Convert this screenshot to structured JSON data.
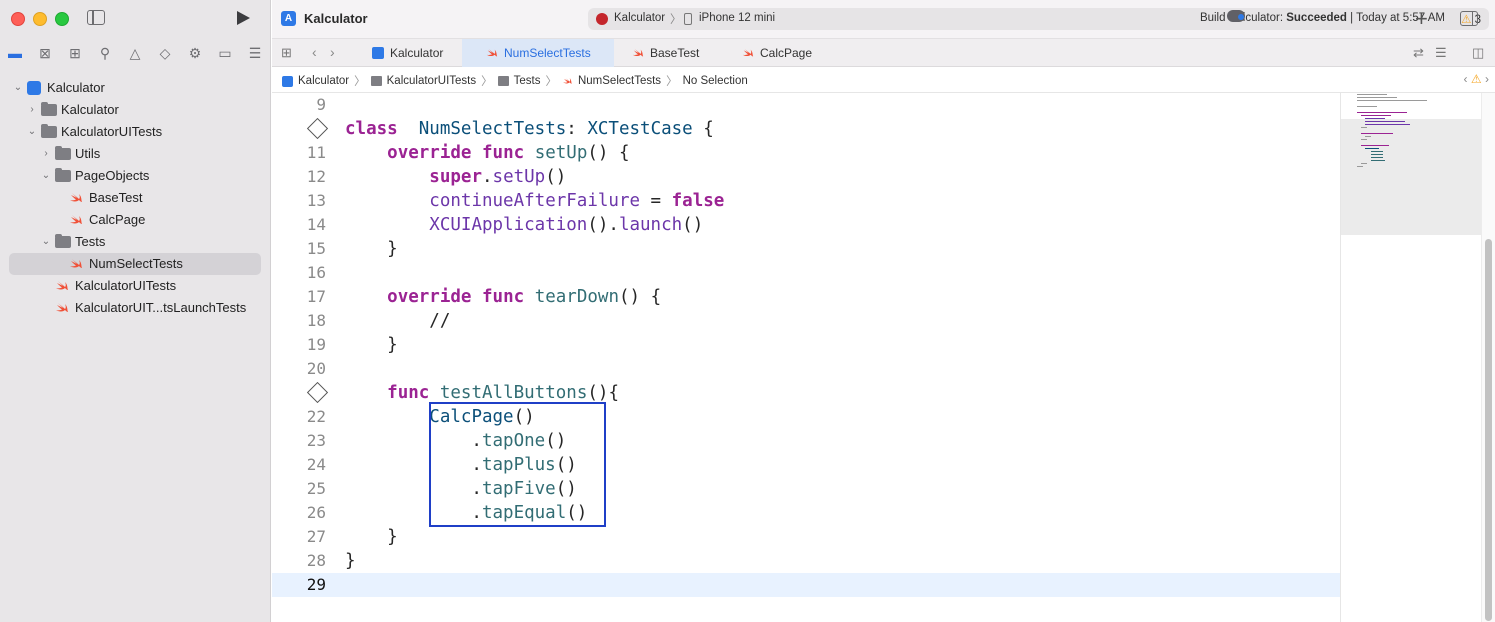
{
  "window": {
    "title": "Kalculator"
  },
  "toolbar": {
    "scheme": "Kalculator",
    "device": "iPhone 12 mini",
    "build_prefix": "Build Kalculator: ",
    "build_result": "Succeeded",
    "build_time": " | Today at 5:57 AM",
    "warning_count": "3",
    "warning_symbol": "⚠"
  },
  "navigator": {
    "tree": [
      {
        "label": "Kalculator",
        "kind": "project",
        "indent": 0,
        "disclosure": "⌄"
      },
      {
        "label": "Kalculator",
        "kind": "folder",
        "indent": 1,
        "disclosure": "›"
      },
      {
        "label": "KalculatorUITests",
        "kind": "folder",
        "indent": 1,
        "disclosure": "⌄"
      },
      {
        "label": "Utils",
        "kind": "folder",
        "indent": 2,
        "disclosure": "›"
      },
      {
        "label": "PageObjects",
        "kind": "folder",
        "indent": 2,
        "disclosure": "⌄"
      },
      {
        "label": "BaseTest",
        "kind": "swift",
        "indent": 3
      },
      {
        "label": "CalcPage",
        "kind": "swift",
        "indent": 3
      },
      {
        "label": "Tests",
        "kind": "folder",
        "indent": 2,
        "disclosure": "⌄"
      },
      {
        "label": "NumSelectTests",
        "kind": "swift",
        "indent": 3,
        "selected": true
      },
      {
        "label": "KalculatorUITests",
        "kind": "swift",
        "indent": 2
      },
      {
        "label": "KalculatorUIT...tsLaunchTests",
        "kind": "swift",
        "indent": 2
      }
    ]
  },
  "tabs": [
    {
      "label": "Kalculator",
      "kind": "project",
      "active": false
    },
    {
      "label": "NumSelectTests",
      "kind": "swift",
      "active": true
    },
    {
      "label": "BaseTest",
      "kind": "swift",
      "active": false
    },
    {
      "label": "CalcPage",
      "kind": "swift",
      "active": false
    }
  ],
  "breadcrumb": [
    {
      "label": "Kalculator",
      "kind": "project"
    },
    {
      "label": "KalculatorUITests",
      "kind": "folder"
    },
    {
      "label": "Tests",
      "kind": "folder"
    },
    {
      "label": "NumSelectTests",
      "kind": "swift"
    },
    {
      "label": "No Selection",
      "kind": "none"
    }
  ],
  "code": {
    "current_line": 29,
    "lines": [
      {
        "n": "9",
        "tokens": []
      },
      {
        "n": "",
        "diamond": true,
        "tokens": [
          [
            "kw",
            "class"
          ],
          [
            "",
            "  "
          ],
          [
            "ty",
            "NumSelectTests"
          ],
          [
            "",
            ": "
          ],
          [
            "ty",
            "XCTestCase"
          ],
          [
            "",
            " {"
          ]
        ]
      },
      {
        "n": "11",
        "tokens": [
          [
            "",
            "    "
          ],
          [
            "kw",
            "override"
          ],
          [
            "",
            " "
          ],
          [
            "kw",
            "func"
          ],
          [
            "",
            " "
          ],
          [
            "fn",
            "setUp"
          ],
          [
            "",
            "() {"
          ]
        ]
      },
      {
        "n": "12",
        "tokens": [
          [
            "",
            "        "
          ],
          [
            "kw",
            "super"
          ],
          [
            "",
            "."
          ],
          [
            "pr",
            "setUp"
          ],
          [
            "",
            "()"
          ]
        ]
      },
      {
        "n": "13",
        "tokens": [
          [
            "",
            "        "
          ],
          [
            "pr",
            "continueAfterFailure"
          ],
          [
            "",
            " = "
          ],
          [
            "kw",
            "false"
          ]
        ]
      },
      {
        "n": "14",
        "tokens": [
          [
            "",
            "        "
          ],
          [
            "pr",
            "XCUIApplication"
          ],
          [
            "",
            "()."
          ],
          [
            "pr",
            "launch"
          ],
          [
            "",
            "()"
          ]
        ]
      },
      {
        "n": "15",
        "tokens": [
          [
            "",
            "    }"
          ]
        ]
      },
      {
        "n": "16",
        "tokens": []
      },
      {
        "n": "17",
        "tokens": [
          [
            "",
            "    "
          ],
          [
            "kw",
            "override"
          ],
          [
            "",
            " "
          ],
          [
            "kw",
            "func"
          ],
          [
            "",
            " "
          ],
          [
            "fn",
            "tearDown"
          ],
          [
            "",
            "() {"
          ]
        ]
      },
      {
        "n": "18",
        "tokens": [
          [
            "",
            "        "
          ],
          [
            "",
            "//"
          ]
        ]
      },
      {
        "n": "19",
        "tokens": [
          [
            "",
            "    }"
          ]
        ]
      },
      {
        "n": "20",
        "tokens": []
      },
      {
        "n": "",
        "diamond": true,
        "tokens": [
          [
            "",
            "    "
          ],
          [
            "kw",
            "func"
          ],
          [
            "",
            " "
          ],
          [
            "fn",
            "testAllButtons"
          ],
          [
            "",
            "(){"
          ]
        ]
      },
      {
        "n": "22",
        "tokens": [
          [
            "",
            "        "
          ],
          [
            "ty",
            "CalcPage"
          ],
          [
            "",
            "()"
          ]
        ]
      },
      {
        "n": "23",
        "tokens": [
          [
            "",
            "            ."
          ],
          [
            "fn",
            "tapOne"
          ],
          [
            "",
            "()"
          ]
        ]
      },
      {
        "n": "24",
        "tokens": [
          [
            "",
            "            ."
          ],
          [
            "fn",
            "tapPlus"
          ],
          [
            "",
            "()"
          ]
        ]
      },
      {
        "n": "25",
        "tokens": [
          [
            "",
            "            ."
          ],
          [
            "fn",
            "tapFive"
          ],
          [
            "",
            "()"
          ]
        ]
      },
      {
        "n": "26",
        "tokens": [
          [
            "",
            "            ."
          ],
          [
            "fn",
            "tapEqual"
          ],
          [
            "",
            "()"
          ]
        ]
      },
      {
        "n": "27",
        "tokens": [
          [
            "",
            "    }"
          ]
        ]
      },
      {
        "n": "28",
        "tokens": [
          [
            "",
            "}"
          ]
        ]
      },
      {
        "n": "29",
        "tokens": []
      }
    ]
  },
  "colors": {
    "keyword": "#9b2393",
    "type": "#0b4f79",
    "function": "#326d74",
    "project_ref": "#6c36a9",
    "accent": "#2a6fe0",
    "highlight_box": "#1f3fc7"
  }
}
